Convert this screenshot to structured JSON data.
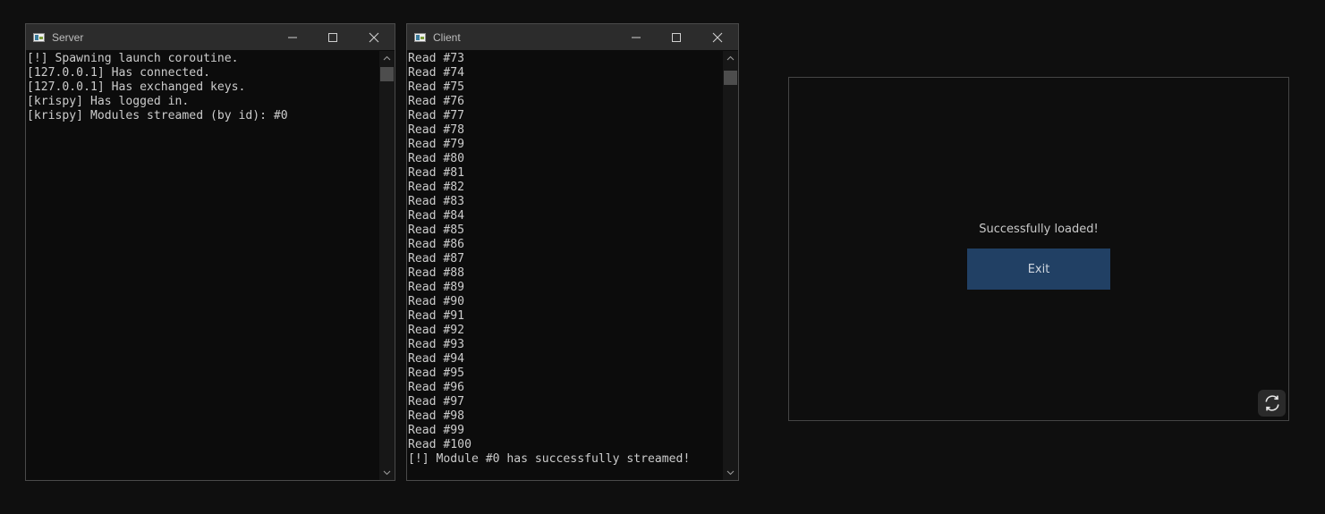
{
  "server_window": {
    "title": "Server",
    "lines": [
      "[!] Spawning launch coroutine.",
      "[127.0.0.1] Has connected.",
      "[127.0.0.1] Has exchanged keys.",
      "[krispy] Has logged in.",
      "[krispy] Modules streamed (by id): #0"
    ]
  },
  "client_window": {
    "title": "Client",
    "lines": [
      "Read #73",
      "Read #74",
      "Read #75",
      "Read #76",
      "Read #77",
      "Read #78",
      "Read #79",
      "Read #80",
      "Read #81",
      "Read #82",
      "Read #83",
      "Read #84",
      "Read #85",
      "Read #86",
      "Read #87",
      "Read #88",
      "Read #89",
      "Read #90",
      "Read #91",
      "Read #92",
      "Read #93",
      "Read #94",
      "Read #95",
      "Read #96",
      "Read #97",
      "Read #98",
      "Read #99",
      "Read #100",
      "[!] Module #0 has successfully streamed!"
    ]
  },
  "loader": {
    "status": "Successfully loaded!",
    "exit_label": "Exit",
    "refresh_icon": "refresh-icon"
  },
  "colors": {
    "background": "#0f0f0f",
    "console_bg": "#0c0c0c",
    "titlebar": "#2c2c2c",
    "console_text": "#cccccc",
    "exit_button": "#214064"
  }
}
